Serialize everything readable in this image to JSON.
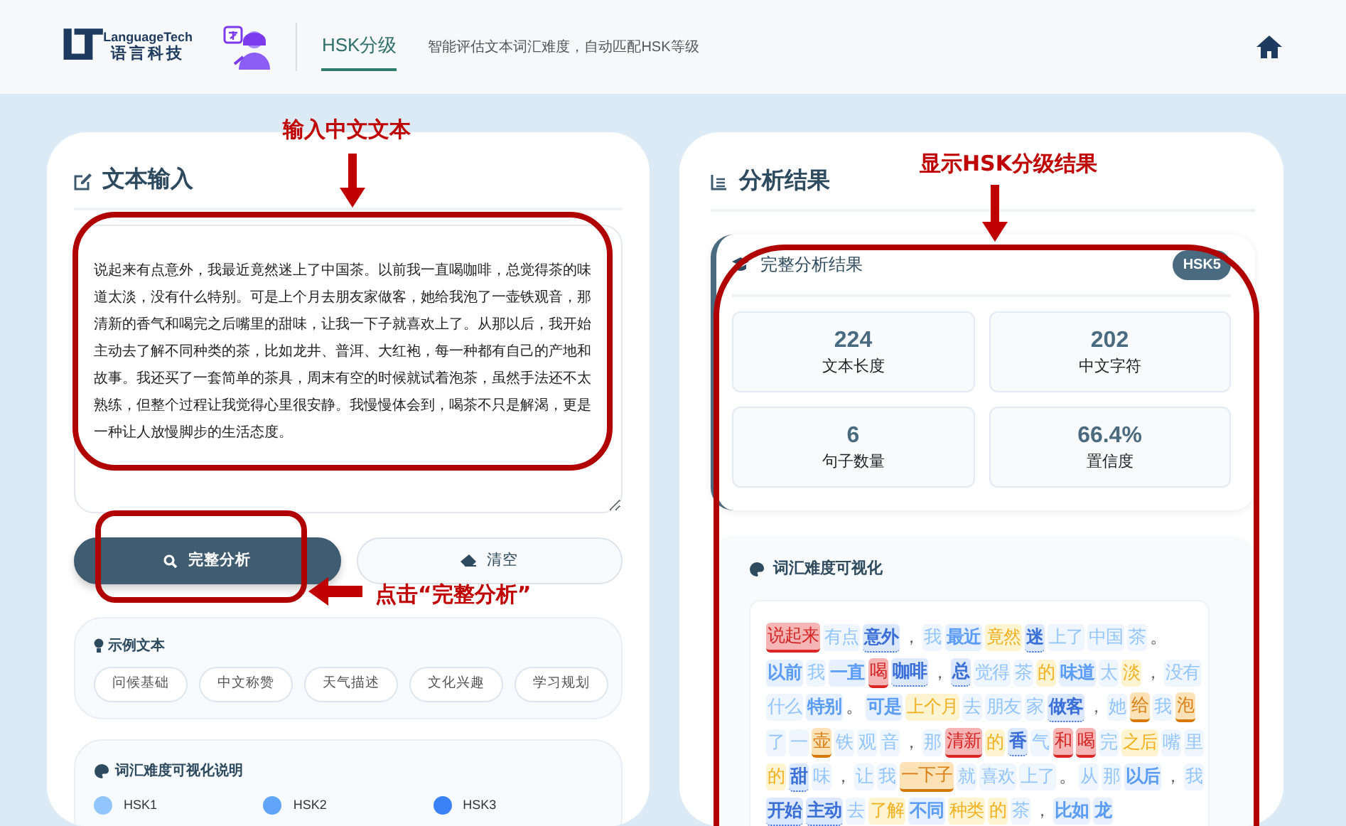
{
  "header": {
    "logo_mark": "LT",
    "logo_name": "LanguageTech",
    "logo_subtitle": "语言科技",
    "nav_tab": {
      "label": "HSK分级",
      "selected": true
    },
    "tagline": "智能评估文本词汇难度，自动匹配HSK等级"
  },
  "input_panel": {
    "title": "文本输入",
    "text": "说起来有点意外，我最近竟然迷上了中国茶。以前我一直喝咖啡，总觉得茶的味道太淡，没有什么特别。可是上个月去朋友家做客，她给我泡了一壶铁观音，那清新的香气和喝完之后嘴里的甜味，让我一下子就喜欢上了。从那以后，我开始主动去了解不同种类的茶，比如龙井、普洱、大红袍，每一种都有自己的产地和故事。我还买了一套简单的茶具，周末有空的时候就试着泡茶，虽然手法还不太熟练，但整个过程让我觉得心里很安静。我慢慢体会到，喝茶不只是解渴，更是一种让人放慢脚步的生活态度。",
    "buttons": [
      {
        "label": "完整分析",
        "kind": "primary"
      },
      {
        "label": "清空",
        "kind": "secondary"
      }
    ],
    "examples": {
      "title": "示例文本",
      "chips": [
        "问候基础",
        "中文称赞",
        "天气描述",
        "文化兴趣",
        "学习规划"
      ]
    },
    "legend": {
      "title": "词汇难度可视化说明",
      "items": [
        {
          "label": "HSK1",
          "color": "#93c5fd"
        },
        {
          "label": "HSK2",
          "color": "#60a5fa"
        },
        {
          "label": "HSK3",
          "color": "#3b82f6"
        }
      ]
    }
  },
  "result_panel": {
    "title": "分析结果",
    "summary": {
      "title": "完整分析结果",
      "badge": "HSK5",
      "stats": [
        {
          "value": "224",
          "label": "文本长度"
        },
        {
          "value": "202",
          "label": "中文字符"
        },
        {
          "value": "6",
          "label": "句子数量"
        },
        {
          "value": "66.4%",
          "label": "置信度"
        }
      ]
    },
    "visualization": {
      "title": "词汇难度可视化",
      "tokens": [
        {
          "text": "说起来",
          "kind": "hsk6"
        },
        {
          "text": "有点",
          "kind": "hsk1"
        },
        {
          "text": "意外",
          "kind": "hsk3"
        },
        {
          "text": "，",
          "kind": "punct"
        },
        {
          "text": "我",
          "kind": "hsk1"
        },
        {
          "text": "最近",
          "kind": "hsk2"
        },
        {
          "text": "竟然",
          "kind": "hsk4"
        },
        {
          "text": "迷",
          "kind": "hsk3"
        },
        {
          "text": "上了",
          "kind": "hsk1"
        },
        {
          "text": "中国",
          "kind": "hsk1"
        },
        {
          "text": "茶",
          "kind": "hsk1"
        },
        {
          "text": "。",
          "kind": "punct"
        },
        {
          "text": "以前",
          "kind": "hsk2"
        },
        {
          "text": "我",
          "kind": "hsk1"
        },
        {
          "text": "一直",
          "kind": "hsk2"
        },
        {
          "text": "喝",
          "kind": "hsk6"
        },
        {
          "text": "咖啡",
          "kind": "hsk3"
        },
        {
          "text": "，",
          "kind": "punct"
        },
        {
          "text": "总",
          "kind": "hsk3"
        },
        {
          "text": "觉得",
          "kind": "hsk1"
        },
        {
          "text": "茶",
          "kind": "hsk1"
        },
        {
          "text": "的",
          "kind": "hsk4"
        },
        {
          "text": "味道",
          "kind": "hsk2"
        },
        {
          "text": "太",
          "kind": "hsk1"
        },
        {
          "text": "淡",
          "kind": "hsk4"
        },
        {
          "text": "，",
          "kind": "punct"
        },
        {
          "text": "没有",
          "kind": "hsk1"
        },
        {
          "text": "什么",
          "kind": "hsk1"
        },
        {
          "text": "特别",
          "kind": "hsk2"
        },
        {
          "text": "。",
          "kind": "punct"
        },
        {
          "text": "可是",
          "kind": "hsk2"
        },
        {
          "text": "上个月",
          "kind": "hsk4"
        },
        {
          "text": "去",
          "kind": "hsk1"
        },
        {
          "text": "朋友",
          "kind": "hsk1"
        },
        {
          "text": "家",
          "kind": "hsk1"
        },
        {
          "text": "做客",
          "kind": "hsk3"
        },
        {
          "text": "，",
          "kind": "punct"
        },
        {
          "text": "她",
          "kind": "hsk1"
        },
        {
          "text": "给",
          "kind": "hsk5"
        },
        {
          "text": "我",
          "kind": "hsk1"
        },
        {
          "text": "泡",
          "kind": "hsk5"
        },
        {
          "text": "了",
          "kind": "hsk1"
        },
        {
          "text": "一",
          "kind": "hsk1"
        },
        {
          "text": "壶",
          "kind": "hsk5"
        },
        {
          "text": "铁",
          "kind": "hsk1"
        },
        {
          "text": "观",
          "kind": "hsk1"
        },
        {
          "text": "音",
          "kind": "hsk1"
        },
        {
          "text": "，",
          "kind": "punct"
        },
        {
          "text": "那",
          "kind": "hsk1"
        },
        {
          "text": "清新",
          "kind": "hsk6"
        },
        {
          "text": "的",
          "kind": "hsk4"
        },
        {
          "text": "香",
          "kind": "hsk3"
        },
        {
          "text": "气",
          "kind": "hsk1"
        },
        {
          "text": "和",
          "kind": "hsk6"
        },
        {
          "text": "喝",
          "kind": "hsk6"
        },
        {
          "text": "完",
          "kind": "hsk1"
        },
        {
          "text": "之后",
          "kind": "hsk4"
        },
        {
          "text": "嘴",
          "kind": "hsk1"
        },
        {
          "text": "里",
          "kind": "hsk1"
        },
        {
          "text": "的",
          "kind": "hsk4"
        },
        {
          "text": "甜",
          "kind": "hsk3"
        },
        {
          "text": "味",
          "kind": "hsk1"
        },
        {
          "text": "，",
          "kind": "punct"
        },
        {
          "text": "让",
          "kind": "hsk1"
        },
        {
          "text": "我",
          "kind": "hsk1"
        },
        {
          "text": "一下子",
          "kind": "hsk5"
        },
        {
          "text": "就",
          "kind": "hsk1"
        },
        {
          "text": "喜欢",
          "kind": "hsk1"
        },
        {
          "text": "上了",
          "kind": "hsk1"
        },
        {
          "text": "。",
          "kind": "punct"
        },
        {
          "text": "从",
          "kind": "hsk1"
        },
        {
          "text": "那",
          "kind": "hsk1"
        },
        {
          "text": "以后",
          "kind": "hsk2"
        },
        {
          "text": "，",
          "kind": "punct"
        },
        {
          "text": "我",
          "kind": "hsk1"
        },
        {
          "text": "开始",
          "kind": "hsk3"
        },
        {
          "text": "主动",
          "kind": "hsk3"
        },
        {
          "text": "去",
          "kind": "hsk1"
        },
        {
          "text": "了解",
          "kind": "hsk4"
        },
        {
          "text": "不同",
          "kind": "hsk2"
        },
        {
          "text": "种类",
          "kind": "hsk4"
        },
        {
          "text": "的",
          "kind": "hsk4"
        },
        {
          "text": "茶",
          "kind": "hsk1"
        },
        {
          "text": "，",
          "kind": "punct"
        },
        {
          "text": "比如",
          "kind": "hsk2"
        },
        {
          "text": "龙",
          "kind": "hsk2"
        }
      ]
    }
  },
  "annotations": [
    {
      "kind": "label",
      "text": "输入中文文本"
    },
    {
      "kind": "label",
      "text": "点击“完整分析”"
    },
    {
      "kind": "label",
      "text": "显示HSK分级结果"
    }
  ]
}
